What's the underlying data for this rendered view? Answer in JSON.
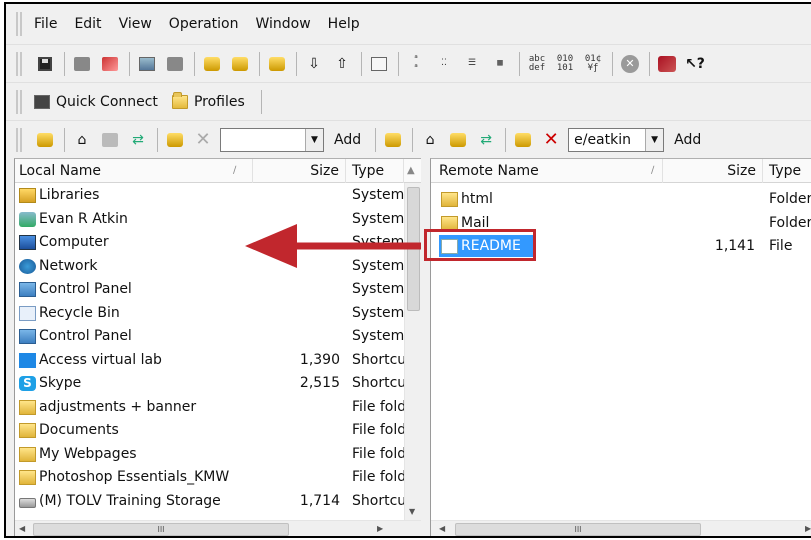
{
  "menu": [
    "File",
    "Edit",
    "View",
    "Operation",
    "Window",
    "Help"
  ],
  "toolbar2": {
    "quick_connect": "Quick Connect",
    "profiles": "Profiles"
  },
  "toolbar3": {
    "left_combo_value": "",
    "left_add": "Add",
    "right_combo_value": "e/eatkin",
    "right_add": "Add"
  },
  "icons": [
    "save-icon",
    "connect-icon",
    "disconnect-icon",
    "copy-icon",
    "paste-icon",
    "search-icon",
    "download-icon",
    "upload-icon",
    "view-icon",
    "sort-icon",
    "detail-icon",
    "list-icon",
    "ascii-icon",
    "binary-icon",
    "auto-icon",
    "stop-icon",
    "book-icon",
    "help-icon"
  ],
  "local": {
    "columns": {
      "name": "Local Name",
      "size": "Size",
      "type": "Type"
    },
    "rows": [
      {
        "name": "Libraries",
        "size": "",
        "type": "System",
        "icon": "libraries-icon"
      },
      {
        "name": "Evan R Atkin",
        "size": "",
        "type": "System",
        "icon": "user-icon"
      },
      {
        "name": "Computer",
        "size": "",
        "type": "System",
        "icon": "computer-icon"
      },
      {
        "name": "Network",
        "size": "",
        "type": "System",
        "icon": "network-icon"
      },
      {
        "name": "Control Panel",
        "size": "",
        "type": "System",
        "icon": "control-panel-icon"
      },
      {
        "name": "Recycle Bin",
        "size": "",
        "type": "System",
        "icon": "recycle-bin-icon"
      },
      {
        "name": "Control Panel",
        "size": "",
        "type": "System",
        "icon": "control-panel-icon"
      },
      {
        "name": "Access virtual lab",
        "size": "1,390",
        "type": "Shortcut",
        "icon": "windows-icon"
      },
      {
        "name": "Skype",
        "size": "2,515",
        "type": "Shortcut",
        "icon": "skype-icon"
      },
      {
        "name": "adjustments + banner",
        "size": "",
        "type": "File folder",
        "icon": "folder-icon"
      },
      {
        "name": "Documents",
        "size": "",
        "type": "File folder",
        "icon": "folder-icon"
      },
      {
        "name": "My Webpages",
        "size": "",
        "type": "File folder",
        "icon": "folder-icon"
      },
      {
        "name": "Photoshop Essentials_KMW",
        "size": "",
        "type": "File folder",
        "icon": "folder-icon"
      },
      {
        "name": "(M) TOLV Training Storage",
        "size": "1,714",
        "type": "Shortcut",
        "icon": "drive-icon"
      }
    ]
  },
  "remote": {
    "columns": {
      "name": "Remote Name",
      "size": "Size",
      "type": "Type"
    },
    "rows": [
      {
        "name": "html",
        "size": "",
        "type": "Folder",
        "icon": "folder-icon"
      },
      {
        "name": "Mail",
        "size": "",
        "type": "Folder",
        "icon": "folder-icon"
      },
      {
        "name": "README",
        "size": "1,141",
        "type": "File",
        "icon": "file-icon",
        "selected": true
      }
    ]
  },
  "annotation": {
    "color": "#c1272d"
  }
}
